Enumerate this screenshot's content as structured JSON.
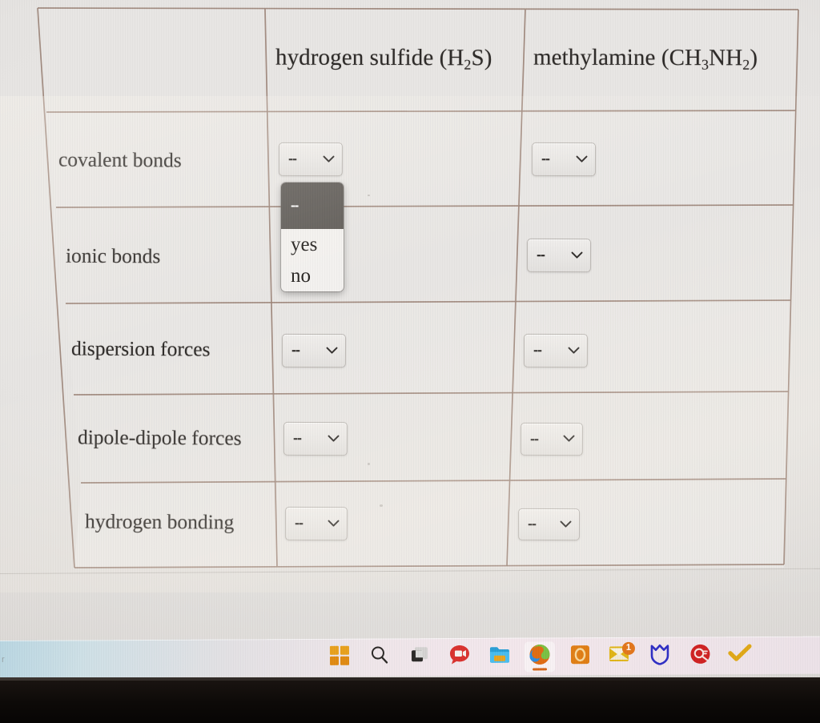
{
  "table": {
    "corner_label": "",
    "columns": [
      {
        "id": "h2s",
        "name_plain": "hydrogen sulfide (H2S)",
        "name_main": "hydrogen sulfide (H",
        "sub": "2",
        "name_tail": "S)"
      },
      {
        "id": "ch3nh2",
        "name_plain": "methylamine (CH3NH2)",
        "name_main": "methylamine (CH",
        "sub": "3",
        "name_mid": "NH",
        "sub2": "2",
        "name_tail": ")"
      }
    ],
    "rows": [
      {
        "label": "covalent bonds",
        "values": [
          "--",
          "--"
        ]
      },
      {
        "label": "ionic bonds",
        "values": [
          "--",
          "--"
        ]
      },
      {
        "label": "dispersion forces",
        "values": [
          "--",
          "--"
        ]
      },
      {
        "label": "dipole-dipole forces",
        "values": [
          "--",
          "--"
        ]
      },
      {
        "label": "hydrogen bonding",
        "values": [
          "--",
          "--"
        ]
      }
    ],
    "border_color": "#9b8377",
    "cell_bg": "#e9e7e5"
  },
  "select": {
    "placeholder": "--",
    "chevron_icon": "chevron-down-icon"
  },
  "dropdown": {
    "open_for_row": "covalent bonds",
    "open_for_column": "hydrogen sulfide (H2S)",
    "options": [
      {
        "label": "--",
        "selected": true
      },
      {
        "label": "yes",
        "selected": false
      },
      {
        "label": "no",
        "selected": false
      }
    ],
    "highlight_color": "#5f5b57"
  },
  "taskbar": {
    "items": [
      {
        "icon": "windows-start-icon",
        "label": "Start",
        "active": false,
        "badge": null
      },
      {
        "icon": "search-icon",
        "label": "Search",
        "active": false,
        "badge": null
      },
      {
        "icon": "task-view-icon",
        "label": "Task View",
        "active": false,
        "badge": null
      },
      {
        "icon": "chat-video-icon",
        "label": "Chat",
        "active": false,
        "badge": null
      },
      {
        "icon": "file-explorer-icon",
        "label": "File Explorer",
        "active": false,
        "badge": null
      },
      {
        "icon": "microsoft-edge-icon",
        "label": "Microsoft Edge",
        "active": true,
        "badge": null
      },
      {
        "icon": "orange-app-icon",
        "label": "Orange App",
        "active": false,
        "badge": null
      },
      {
        "icon": "mail-icon",
        "label": "Mail",
        "active": false,
        "badge": "1"
      },
      {
        "icon": "shield-icon",
        "label": "Security",
        "active": false,
        "badge": null
      },
      {
        "icon": "red-circle-app-icon",
        "label": "Red App",
        "active": false,
        "badge": null
      },
      {
        "icon": "checkmark-icon",
        "label": "Tasks",
        "active": false,
        "badge": null
      }
    ]
  },
  "artifacts": {
    "corner_mark": "r"
  }
}
